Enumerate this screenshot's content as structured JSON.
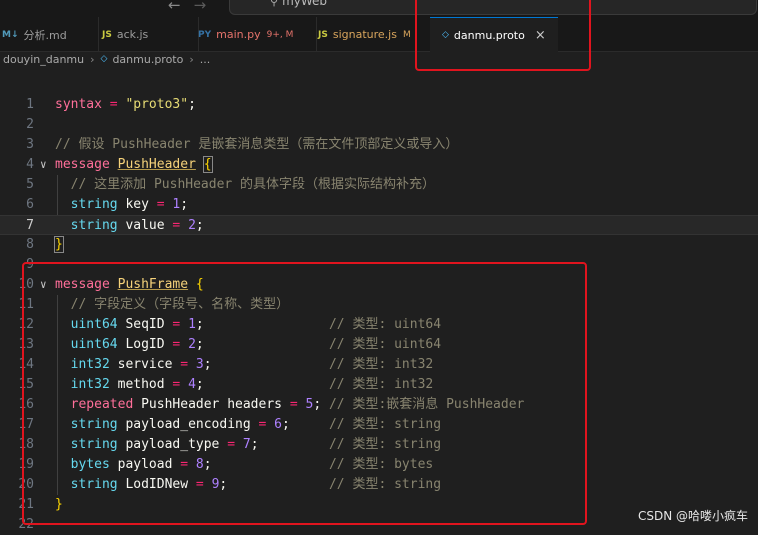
{
  "titlebar": {
    "back_glyph": "←",
    "forward_glyph": "→",
    "search_icon": "⚲",
    "search_text": "myWeb"
  },
  "tabs": [
    {
      "icon": "M↓",
      "icon_color": "#519aba",
      "label": "分析.md",
      "modified": "",
      "active": false
    },
    {
      "icon": "JS",
      "icon_color": "#cbcb41",
      "label": "ack.js",
      "modified": "",
      "active": false
    },
    {
      "icon": "PY",
      "icon_color": "#3572a5",
      "label": "main.py",
      "modified": "9+, M",
      "active": false
    },
    {
      "icon": "JS",
      "icon_color": "#cbcb41",
      "label": "signature.js",
      "modified": "M",
      "active": false
    },
    {
      "icon": "◇",
      "icon_color": "#4fc1ff",
      "label": "danmu.proto",
      "modified": "",
      "active": true,
      "close": "×"
    }
  ],
  "breadcrumb": {
    "folder": "douyin_danmu",
    "file": "danmu.proto",
    "ellipsis": "..."
  },
  "editor": {
    "current_line": 7,
    "lines": [
      {
        "n": "1",
        "fold": "",
        "indent": 0,
        "tokens": [
          [
            "kw",
            "syntax"
          ],
          [
            "op",
            " = "
          ],
          [
            "str",
            "\"proto3\""
          ],
          [
            "punc",
            ";"
          ]
        ]
      },
      {
        "n": "2",
        "fold": "",
        "indent": 0,
        "tokens": []
      },
      {
        "n": "3",
        "fold": "",
        "indent": 0,
        "tokens": [
          [
            "cmt",
            "// 假设 PushHeader 是嵌套消息类型（需在文件顶部定义或导入）"
          ]
        ]
      },
      {
        "n": "4",
        "fold": "∨",
        "indent": 0,
        "tokens": [
          [
            "kw",
            "message "
          ],
          [
            "cls",
            "PushHeader"
          ],
          [
            "ident",
            " "
          ],
          [
            "bracehl",
            "{"
          ]
        ]
      },
      {
        "n": "5",
        "fold": "",
        "indent": 1,
        "tokens": [
          [
            "cmt",
            "  // 这里添加 PushHeader 的具体字段（根据实际结构补充）"
          ]
        ]
      },
      {
        "n": "6",
        "fold": "",
        "indent": 1,
        "tokens": [
          [
            "typ",
            "  string"
          ],
          [
            "ident",
            " key"
          ],
          [
            "op",
            " = "
          ],
          [
            "num",
            "1"
          ],
          [
            "punc",
            ";"
          ]
        ]
      },
      {
        "n": "7",
        "fold": "",
        "indent": 1,
        "tokens": [
          [
            "typ",
            "  string"
          ],
          [
            "ident",
            " value"
          ],
          [
            "op",
            " = "
          ],
          [
            "num",
            "2"
          ],
          [
            "punc",
            ";"
          ]
        ]
      },
      {
        "n": "8",
        "fold": "",
        "indent": 0,
        "tokens": [
          [
            "bracehl",
            "}"
          ]
        ]
      },
      {
        "n": "9",
        "fold": "",
        "indent": 0,
        "tokens": []
      },
      {
        "n": "10",
        "fold": "∨",
        "indent": 0,
        "tokens": [
          [
            "kw",
            "message "
          ],
          [
            "cls",
            "PushFrame"
          ],
          [
            "ident",
            " "
          ],
          [
            "brace",
            "{"
          ]
        ]
      },
      {
        "n": "11",
        "fold": "",
        "indent": 1,
        "tokens": [
          [
            "cmt",
            "  // 字段定义（字段号、名称、类型）"
          ]
        ]
      },
      {
        "n": "12",
        "fold": "",
        "indent": 1,
        "tokens": [
          [
            "typ",
            "  uint64"
          ],
          [
            "ident",
            " SeqID"
          ],
          [
            "op",
            " = "
          ],
          [
            "num",
            "1"
          ],
          [
            "punc",
            ";"
          ],
          [
            "ident",
            "                "
          ],
          [
            "cmt",
            "// 类型: uint64"
          ]
        ]
      },
      {
        "n": "13",
        "fold": "",
        "indent": 1,
        "tokens": [
          [
            "typ",
            "  uint64"
          ],
          [
            "ident",
            " LogID"
          ],
          [
            "op",
            " = "
          ],
          [
            "num",
            "2"
          ],
          [
            "punc",
            ";"
          ],
          [
            "ident",
            "                "
          ],
          [
            "cmt",
            "// 类型: uint64"
          ]
        ]
      },
      {
        "n": "14",
        "fold": "",
        "indent": 1,
        "tokens": [
          [
            "typ",
            "  int32"
          ],
          [
            "ident",
            " service"
          ],
          [
            "op",
            " = "
          ],
          [
            "num",
            "3"
          ],
          [
            "punc",
            ";"
          ],
          [
            "ident",
            "               "
          ],
          [
            "cmt",
            "// 类型: int32"
          ]
        ]
      },
      {
        "n": "15",
        "fold": "",
        "indent": 1,
        "tokens": [
          [
            "typ",
            "  int32"
          ],
          [
            "ident",
            " method"
          ],
          [
            "op",
            " = "
          ],
          [
            "num",
            "4"
          ],
          [
            "punc",
            ";"
          ],
          [
            "ident",
            "                "
          ],
          [
            "cmt",
            "// 类型: int32"
          ]
        ]
      },
      {
        "n": "16",
        "fold": "",
        "indent": 1,
        "tokens": [
          [
            "kw2",
            "  repeated"
          ],
          [
            "ident",
            " PushHeader headers"
          ],
          [
            "op",
            " = "
          ],
          [
            "num",
            "5"
          ],
          [
            "punc",
            ";"
          ],
          [
            "ident",
            " "
          ],
          [
            "cmt",
            "// 类型:嵌套消息 PushHeader"
          ]
        ]
      },
      {
        "n": "17",
        "fold": "",
        "indent": 1,
        "tokens": [
          [
            "typ",
            "  string"
          ],
          [
            "ident",
            " payload_encoding"
          ],
          [
            "op",
            " = "
          ],
          [
            "num",
            "6"
          ],
          [
            "punc",
            ";"
          ],
          [
            "ident",
            "     "
          ],
          [
            "cmt",
            "// 类型: string"
          ]
        ]
      },
      {
        "n": "18",
        "fold": "",
        "indent": 1,
        "tokens": [
          [
            "typ",
            "  string"
          ],
          [
            "ident",
            " payload_type"
          ],
          [
            "op",
            " = "
          ],
          [
            "num",
            "7"
          ],
          [
            "punc",
            ";"
          ],
          [
            "ident",
            "         "
          ],
          [
            "cmt",
            "// 类型: string"
          ]
        ]
      },
      {
        "n": "19",
        "fold": "",
        "indent": 1,
        "tokens": [
          [
            "typ",
            "  bytes"
          ],
          [
            "ident",
            " payload"
          ],
          [
            "op",
            " = "
          ],
          [
            "num",
            "8"
          ],
          [
            "punc",
            ";"
          ],
          [
            "ident",
            "               "
          ],
          [
            "cmt",
            "// 类型: bytes"
          ]
        ]
      },
      {
        "n": "20",
        "fold": "",
        "indent": 1,
        "tokens": [
          [
            "typ",
            "  string"
          ],
          [
            "ident",
            " LodIDNew"
          ],
          [
            "op",
            " = "
          ],
          [
            "num",
            "9"
          ],
          [
            "punc",
            ";"
          ],
          [
            "ident",
            "             "
          ],
          [
            "cmt",
            "// 类型: string"
          ]
        ]
      },
      {
        "n": "21",
        "fold": "",
        "indent": 0,
        "tokens": [
          [
            "brace",
            "}"
          ]
        ]
      },
      {
        "n": "22",
        "fold": "",
        "indent": 0,
        "tokens": []
      }
    ]
  },
  "watermark": "CSDN @哈喽小疯车"
}
